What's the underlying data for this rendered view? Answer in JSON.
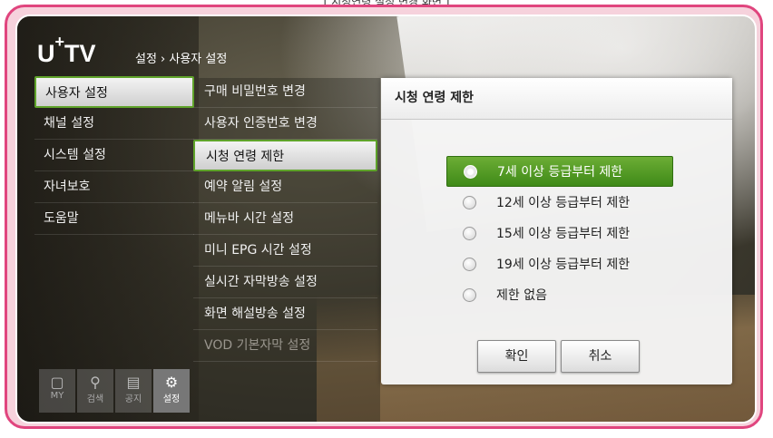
{
  "caption": "[ 시청연령 설정 변경 화면 ]",
  "header": {
    "logo_main": "U",
    "logo_sup": "+",
    "logo_tail": "TV",
    "breadcrumb": "설정 › 사용자 설정"
  },
  "menu1": [
    {
      "label": "사용자 설정",
      "selected": true
    },
    {
      "label": "채널 설정"
    },
    {
      "label": "시스템 설정"
    },
    {
      "label": "자녀보호"
    },
    {
      "label": "도움말"
    }
  ],
  "menu2": [
    {
      "label": "구매 비밀번호 변경"
    },
    {
      "label": "사용자 인증번호 변경"
    },
    {
      "label": "시청 연령 제한",
      "selected": true
    },
    {
      "label": "예약 알림 설정"
    },
    {
      "label": "메뉴바 시간 설정"
    },
    {
      "label": "미니 EPG 시간 설정"
    },
    {
      "label": "실시간 자막방송 설정"
    },
    {
      "label": "화면 해설방송 설정"
    },
    {
      "label": "VOD 기본자막 설정",
      "dim": true
    }
  ],
  "bottom_icons": [
    {
      "icon": "my-icon",
      "label": "MY"
    },
    {
      "icon": "search-icon",
      "label": "검색"
    },
    {
      "icon": "notice-icon",
      "label": "공지"
    },
    {
      "icon": "gear-icon",
      "label": "설정",
      "active": true
    }
  ],
  "panel": {
    "title": "시청 연령 제한",
    "options": [
      {
        "label": "7세 이상 등급부터 제한",
        "selected": true
      },
      {
        "label": "12세 이상 등급부터 제한"
      },
      {
        "label": "15세 이상 등급부터 제한"
      },
      {
        "label": "19세 이상 등급부터 제한"
      },
      {
        "label": "제한 없음"
      }
    ],
    "confirm_label": "확인",
    "cancel_label": "취소"
  },
  "colors": {
    "frame": "#e0457e",
    "selection_green": "#5fa32a"
  }
}
